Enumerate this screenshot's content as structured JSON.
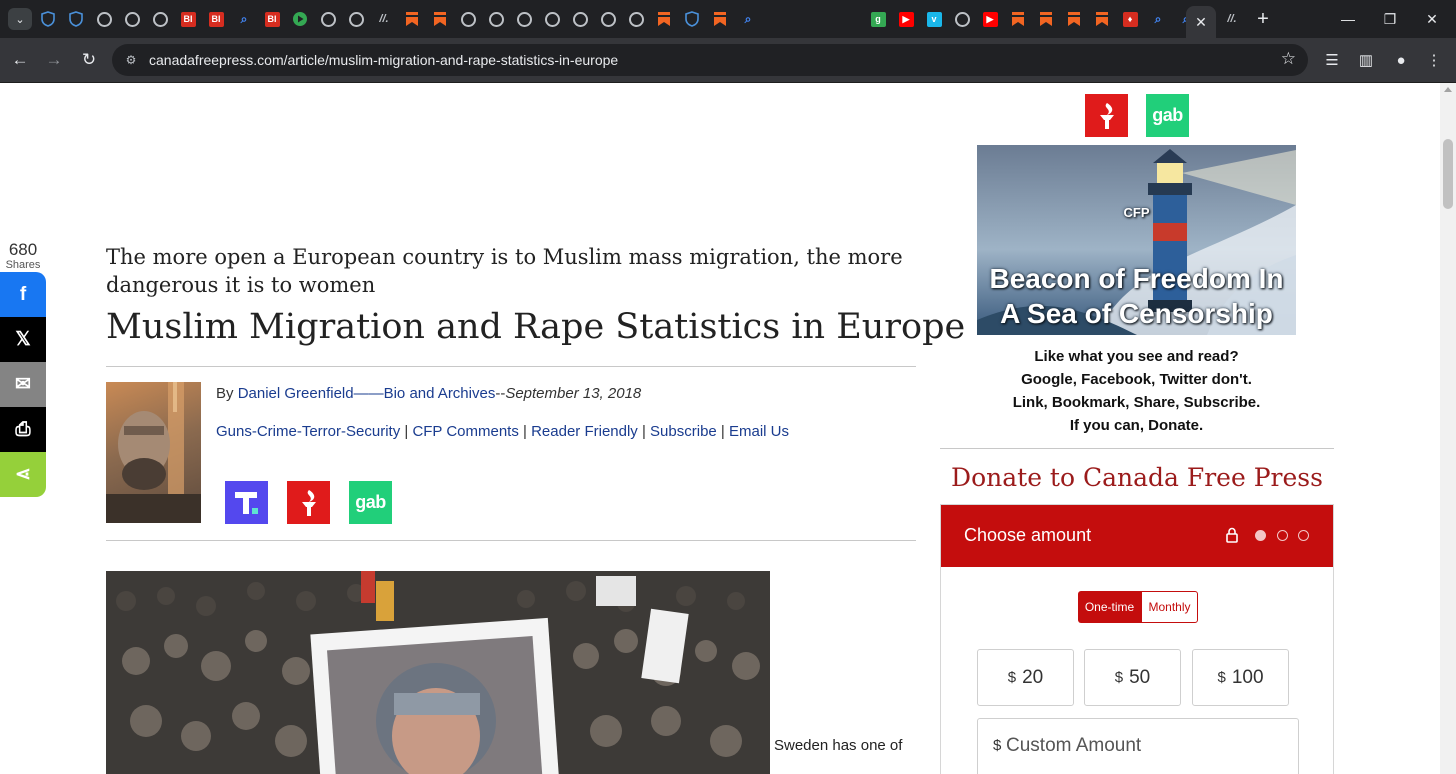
{
  "browser": {
    "url": "canadafreepress.com/article/muslim-migration-and-rape-statistics-in-europe",
    "tab_favicons": [
      {
        "icon": "shield-icon",
        "color": "#4a90d9",
        "text": ""
      },
      {
        "icon": "shield-icon",
        "color": "#4a90d9",
        "text": ""
      },
      {
        "icon": "globe-icon",
        "color": "#bdc1c6",
        "text": ""
      },
      {
        "icon": "globe-icon",
        "color": "#bdc1c6",
        "text": ""
      },
      {
        "icon": "globe-icon",
        "color": "#bdc1c6",
        "text": ""
      },
      {
        "icon": "bi-logo-icon",
        "color": "#d62d20",
        "text": "BI"
      },
      {
        "icon": "bi-logo-icon",
        "color": "#d62d20",
        "text": "BI"
      },
      {
        "icon": "search-icon",
        "color": "#4285f4",
        "text": ""
      },
      {
        "icon": "bi-logo-icon",
        "color": "#d62d20",
        "text": "BI"
      },
      {
        "icon": "play-icon",
        "color": "#34a853",
        "text": ""
      },
      {
        "icon": "globe-icon",
        "color": "#bdc1c6",
        "text": ""
      },
      {
        "icon": "globe-icon",
        "color": "#bdc1c6",
        "text": ""
      },
      {
        "icon": "slash-icon",
        "color": "#bdc1c6",
        "text": ""
      },
      {
        "icon": "bookmark-icon",
        "color": "#f26522",
        "text": ""
      },
      {
        "icon": "bookmark-icon",
        "color": "#f26522",
        "text": ""
      },
      {
        "icon": "globe-icon",
        "color": "#bdc1c6",
        "text": ""
      },
      {
        "icon": "globe-icon",
        "color": "#bdc1c6",
        "text": ""
      },
      {
        "icon": "globe-icon",
        "color": "#bdc1c6",
        "text": ""
      },
      {
        "icon": "globe-icon",
        "color": "#bdc1c6",
        "text": ""
      },
      {
        "icon": "globe-icon",
        "color": "#bdc1c6",
        "text": ""
      },
      {
        "icon": "globe-icon",
        "color": "#bdc1c6",
        "text": ""
      },
      {
        "icon": "globe-icon",
        "color": "#bdc1c6",
        "text": ""
      },
      {
        "icon": "bookmark-icon",
        "color": "#f26522",
        "text": ""
      },
      {
        "icon": "shield-icon",
        "color": "#4a90d9",
        "text": ""
      },
      {
        "icon": "bookmark-icon",
        "color": "#f26522",
        "text": ""
      },
      {
        "icon": "search-icon",
        "color": "#4285f4",
        "text": ""
      },
      {
        "icon": "g-logo-icon",
        "color": "#34a853",
        "text": "g"
      },
      {
        "icon": "youtube-icon",
        "color": "#ff0000",
        "text": "▶"
      },
      {
        "icon": "vimeo-icon",
        "color": "#1ab7ea",
        "text": "v"
      },
      {
        "icon": "globe-icon",
        "color": "#bdc1c6",
        "text": ""
      },
      {
        "icon": "youtube-icon",
        "color": "#ff0000",
        "text": "▶"
      },
      {
        "icon": "bookmark-icon",
        "color": "#f26522",
        "text": ""
      },
      {
        "icon": "bookmark-icon",
        "color": "#f26522",
        "text": ""
      },
      {
        "icon": "bookmark-icon",
        "color": "#f26522",
        "text": ""
      },
      {
        "icon": "bookmark-icon",
        "color": "#f26522",
        "text": ""
      },
      {
        "icon": "torch-icon",
        "color": "#d62d20",
        "text": ""
      },
      {
        "icon": "search-icon",
        "color": "#4285f4",
        "text": ""
      },
      {
        "icon": "search-icon",
        "color": "#4285f4",
        "text": ""
      }
    ]
  },
  "share_bar": {
    "count": "680",
    "count_label": "Shares",
    "buttons": [
      {
        "icon": "facebook-icon",
        "glyph": "f",
        "color": "#1877f2"
      },
      {
        "icon": "x-icon",
        "glyph": "𝕏",
        "color": "#000000"
      },
      {
        "icon": "email-icon",
        "glyph": "✉",
        "color": "#848484"
      },
      {
        "icon": "print-icon",
        "glyph": "⎙",
        "color": "#000000"
      },
      {
        "icon": "share-icon",
        "glyph": "⋖",
        "color": "#95d03a"
      }
    ]
  },
  "article": {
    "subheadline": "The more open a European country is to Muslim mass migration, the more dangerous it is to women",
    "headline": "Muslim Migration and Rape Statistics in Europe",
    "byline_prefix": "By",
    "author": "Daniel Greenfield",
    "bio_link": "——Bio and Archives",
    "date_sep": "--",
    "date": "September 13, 2018",
    "categories": [
      {
        "label": "Guns-Crime-Terror-Security",
        "sep": " | "
      },
      {
        "label": "CFP Comments",
        "sep": " | "
      },
      {
        "label": "Reader Friendly",
        "sep": " | "
      },
      {
        "label": "Subscribe",
        "sep": " | "
      },
      {
        "label": "Email Us",
        "sep": ""
      }
    ],
    "social": [
      {
        "icon": "truth-social-icon",
        "text": "T",
        "color": "#5448ee"
      },
      {
        "icon": "torch-icon",
        "text": "",
        "color": "#e01b1b"
      },
      {
        "icon": "gab-icon",
        "text": "gab",
        "color": "#21cf7a"
      }
    ],
    "body_start": "Sweden has one of"
  },
  "sidebar": {
    "social": [
      {
        "icon": "torch-icon",
        "text": "",
        "color": "#e01b1b"
      },
      {
        "icon": "gab-icon",
        "text": "gab",
        "color": "#21cf7a"
      }
    ],
    "beacon_badge": "CFP",
    "beacon_line1": "Beacon of Freedom In",
    "beacon_line2": "A Sea of Censorship",
    "promo_lines": [
      "Like what you see and read?",
      "Google, Facebook, Twitter don't.",
      "Link, Bookmark, Share, Subscribe.",
      "If you can, Donate."
    ],
    "donate_title": "Donate to Canada Free Press",
    "donate": {
      "header": "Choose amount",
      "accent": "#c40d0d",
      "freq_one_time": "One-time",
      "freq_monthly": "Monthly",
      "currency": "$",
      "amounts": [
        "20",
        "50",
        "100"
      ],
      "custom_placeholder": "Custom Amount"
    }
  }
}
